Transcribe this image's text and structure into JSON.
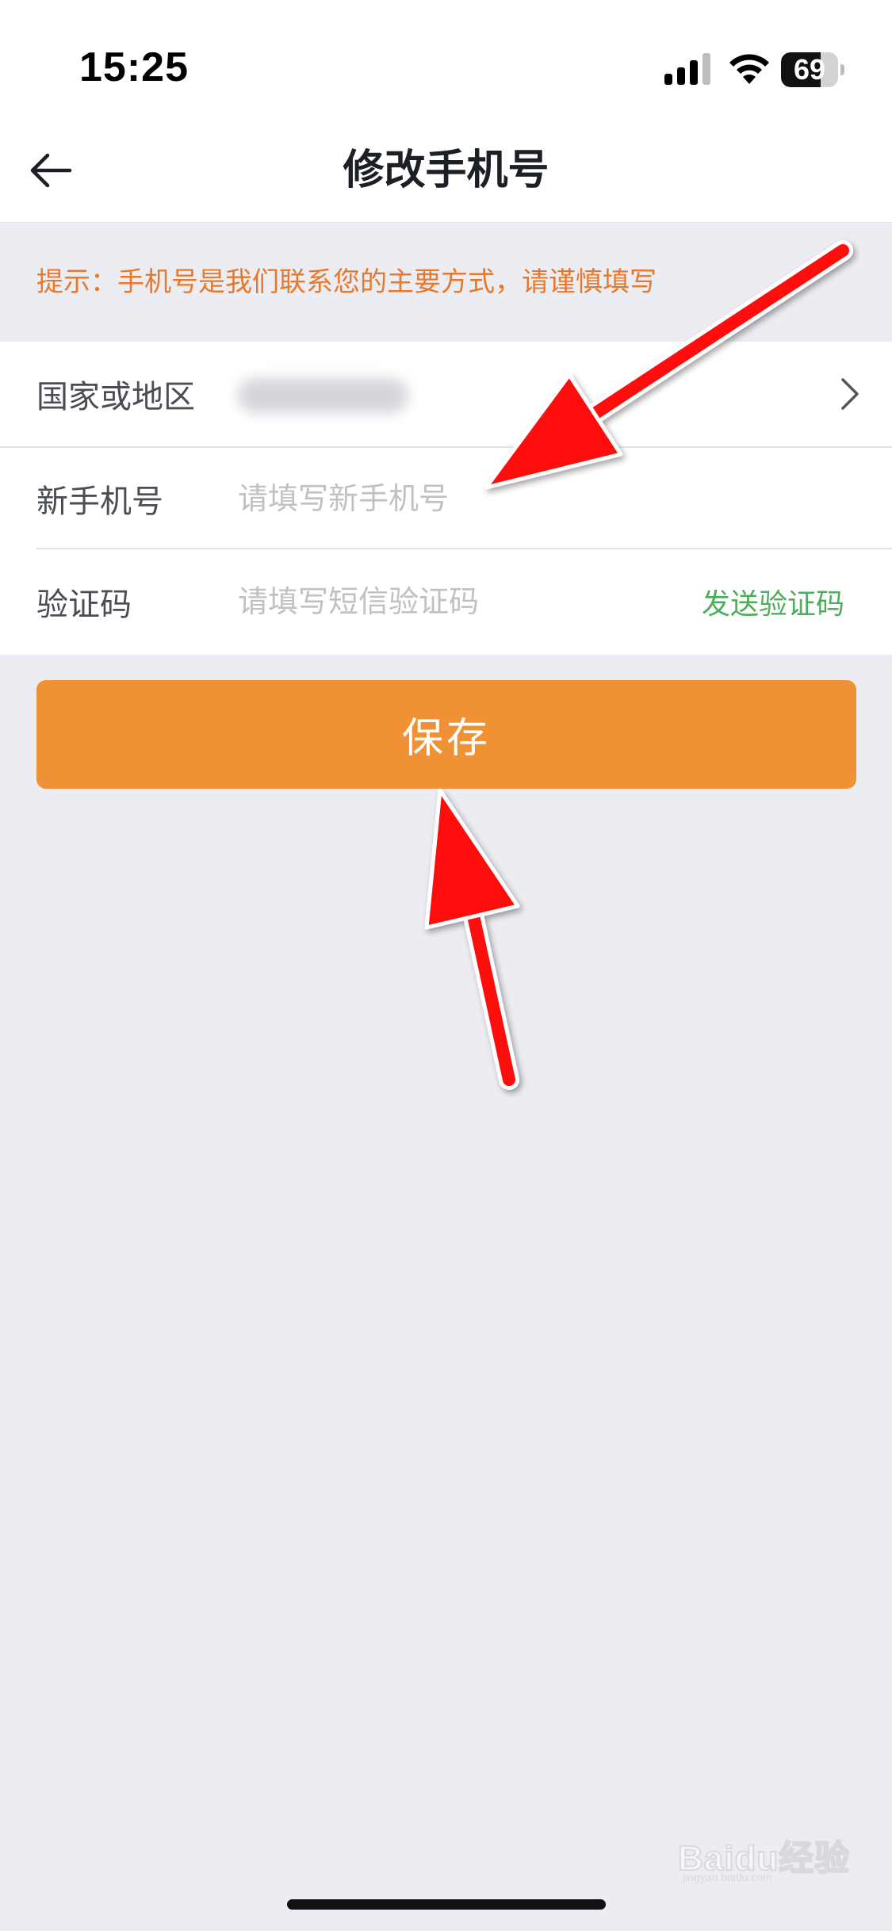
{
  "status_bar": {
    "time": "15:25",
    "battery_level": "69",
    "battery_fraction": 0.69,
    "icons": [
      "signal-icon",
      "wifi-icon",
      "battery-icon"
    ]
  },
  "header": {
    "title": "修改手机号",
    "back_icon": "arrow-left-icon"
  },
  "notice": {
    "text": "提示：手机号是我们联系您的主要方式，请谨慎填写",
    "color": "#e8782c"
  },
  "form": {
    "region": {
      "label": "国家或地区",
      "icon": "chevron-right-icon"
    },
    "phone": {
      "label": "新手机号",
      "placeholder": "请填写新手机号",
      "value": ""
    },
    "code": {
      "label": "验证码",
      "placeholder": "请填写短信验证码",
      "value": "",
      "send_label": "发送验证码",
      "send_color": "#4cae5a"
    }
  },
  "save_button": {
    "label": "保存",
    "color": "#f09136"
  },
  "watermark": {
    "text": "Baidu经验",
    "sub": "jingyan.baidu.com"
  },
  "annotation": {
    "color": "#ff0000"
  }
}
